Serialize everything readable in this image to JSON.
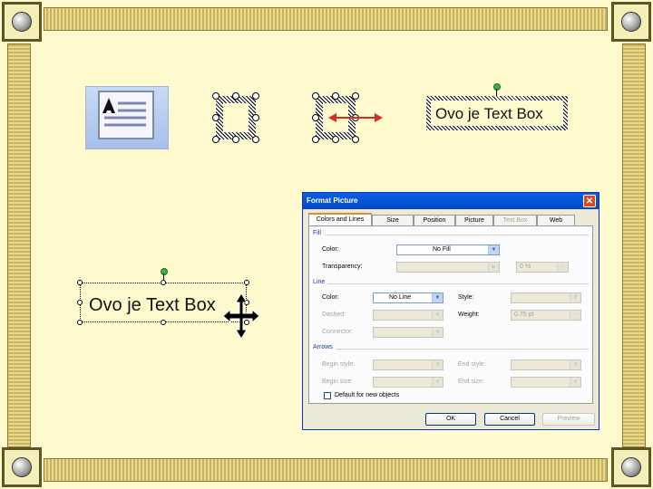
{
  "slide": {
    "colors": {
      "background": "#fffbcf",
      "frame": "#cbb65c"
    },
    "textbox_sample_top": "Ovo je Text Box",
    "textbox_sample_bottom": "Ovo je Text Box",
    "icons": [
      "text-box-tool-icon",
      "selection-frame-icon",
      "resize-arrow-icon",
      "move-cursor-icon"
    ]
  },
  "dialog": {
    "title": "Format Picture",
    "close": "✕",
    "tabs": [
      {
        "label": "Colors and Lines",
        "state": "active"
      },
      {
        "label": "Size",
        "state": "normal"
      },
      {
        "label": "Position",
        "state": "normal"
      },
      {
        "label": "Picture",
        "state": "normal"
      },
      {
        "label": "Text Box",
        "state": "disabled"
      },
      {
        "label": "Web",
        "state": "normal"
      }
    ],
    "fill": {
      "section": "Fill",
      "color_label": "Color:",
      "color_value": "No Fill",
      "transparency_label": "Transparency:",
      "transparency_value": "0 %"
    },
    "line": {
      "section": "Line",
      "color_label": "Color:",
      "color_value": "No Line",
      "style_label": "Style:",
      "dashed_label": "Dashed:",
      "weight_label": "Weight:",
      "weight_value": "0.75 pt",
      "connector_label": "Connector:"
    },
    "arrows": {
      "section": "Arrows",
      "begin_style_label": "Begin style:",
      "end_style_label": "End style:",
      "begin_size_label": "Begin size:",
      "end_size_label": "End size:"
    },
    "default_label": "Default for new objects",
    "buttons": {
      "ok": "OK",
      "cancel": "Cancel",
      "preview": "Preview"
    }
  }
}
